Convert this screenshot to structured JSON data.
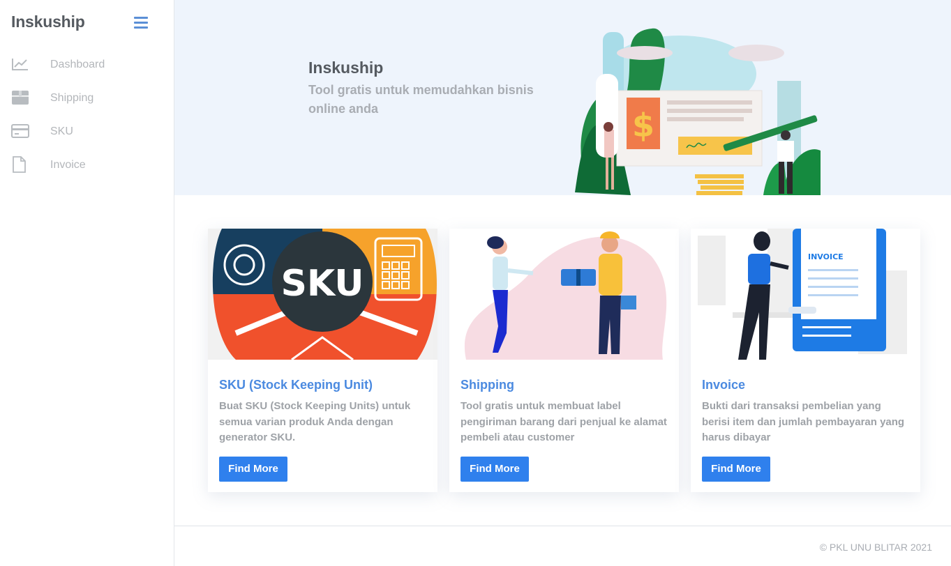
{
  "sidebar": {
    "brand": "Inskuship",
    "menu_icon": "hamburger-menu-icon",
    "items": [
      {
        "label": "Dashboard",
        "icon": "chart-line-icon"
      },
      {
        "label": "Shipping",
        "icon": "box-icon"
      },
      {
        "label": "SKU",
        "icon": "credit-card-icon"
      },
      {
        "label": "Invoice",
        "icon": "document-icon"
      }
    ]
  },
  "hero": {
    "title": "Inskuship",
    "subtitle": "Tool gratis untuk memudahkan bisnis online anda"
  },
  "cards": [
    {
      "illustration": "SKU",
      "title": "SKU (Stock Keeping Unit)",
      "text": "Buat SKU (Stock Keeping Units) untuk semua varian produk Anda dengan generator SKU.",
      "button": "Find More"
    },
    {
      "title": "Shipping",
      "text": "Tool gratis untuk membuat label pengiriman barang dari penjual ke alamat pembeli atau customer",
      "button": "Find More"
    },
    {
      "illustration": "INVOICE",
      "title": "Invoice",
      "text": "Bukti dari transaksi pembelian yang berisi item dan jumlah pembayaran yang harus dibayar",
      "button": "Find More"
    }
  ],
  "footer": {
    "text": "© PKL UNU BLITAR 2021"
  },
  "colors": {
    "accent": "#2f80ed",
    "hero_bg": "#eef4fc",
    "title_blue": "#4b8ae0"
  }
}
